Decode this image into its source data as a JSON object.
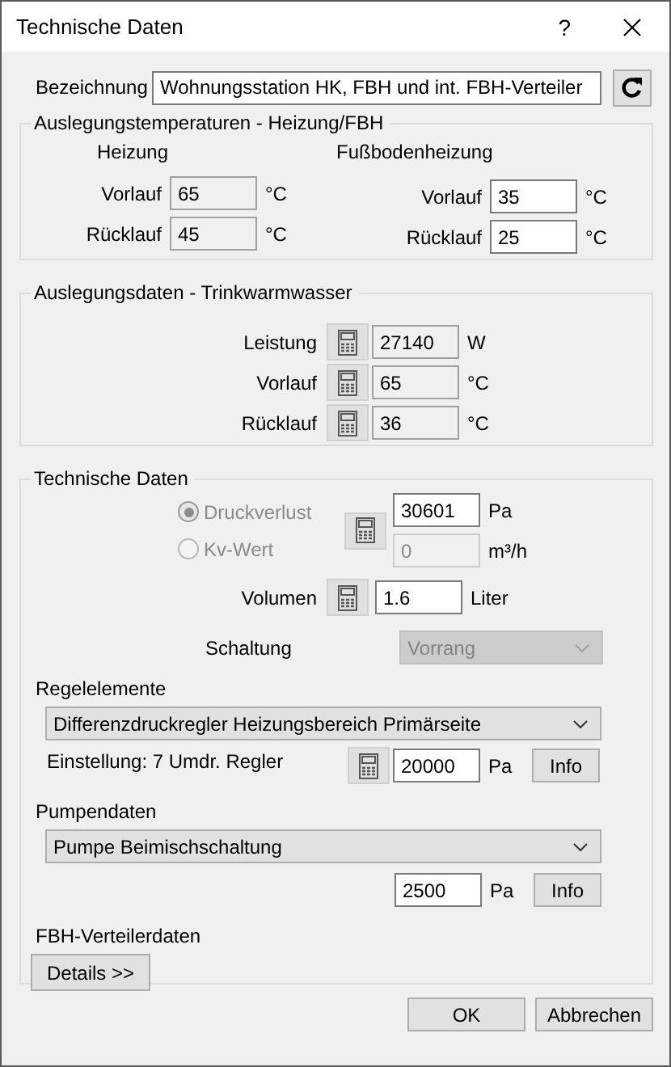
{
  "window": {
    "title": "Technische Daten",
    "help": "?"
  },
  "designation": {
    "label": "Bezeichnung",
    "value": "Wohnungsstation HK, FBH und int. FBH-Verteiler"
  },
  "heating_temps": {
    "title": "Auslegungstemperaturen - Heizung/FBH",
    "columns": [
      {
        "heading": "Heizung",
        "readonly": true,
        "rows": [
          {
            "label": "Vorlauf",
            "value": "65",
            "unit": "°C"
          },
          {
            "label": "Rücklauf",
            "value": "45",
            "unit": "°C"
          }
        ]
      },
      {
        "heading": "Fußbodenheizung",
        "readonly": false,
        "rows": [
          {
            "label": "Vorlauf",
            "value": "35",
            "unit": "°C"
          },
          {
            "label": "Rücklauf",
            "value": "25",
            "unit": "°C"
          }
        ]
      }
    ]
  },
  "dhw": {
    "title": "Auslegungsdaten - Trinkwarmwasser",
    "rows": [
      {
        "label": "Leistung",
        "value": "27140",
        "unit": "W"
      },
      {
        "label": "Vorlauf",
        "value": "65",
        "unit": "°C"
      },
      {
        "label": "Rücklauf",
        "value": "36",
        "unit": "°C"
      }
    ]
  },
  "technical": {
    "title": "Technische Daten",
    "options": [
      {
        "label": "Druckverlust",
        "selected": true,
        "disabled": true,
        "value": "30601",
        "unit": "Pa",
        "field_disabled": false
      },
      {
        "label": "Kv-Wert",
        "selected": false,
        "disabled": true,
        "value": "0",
        "unit": "m³/h",
        "field_disabled": true
      }
    ],
    "volume": {
      "label": "Volumen",
      "value": "1.6",
      "unit": "Liter"
    },
    "switching": {
      "label": "Schaltung",
      "value": "Vorrang",
      "disabled": true
    },
    "control": {
      "title": "Regelelemente",
      "value": "Differenzdruckregler Heizungsbereich Primärseite",
      "setting": "Einstellung: 7 Umdr. Regler",
      "pressure": "20000",
      "unit": "Pa",
      "info": "Info"
    },
    "pump": {
      "title": "Pumpendaten",
      "value": "Pumpe Beimischschaltung",
      "pressure": "2500",
      "unit": "Pa",
      "info": "Info"
    },
    "distributor": {
      "title": "FBH-Verteilerdaten",
      "button": "Details >>"
    }
  },
  "buttons": [
    "OK",
    "Abbrechen"
  ]
}
